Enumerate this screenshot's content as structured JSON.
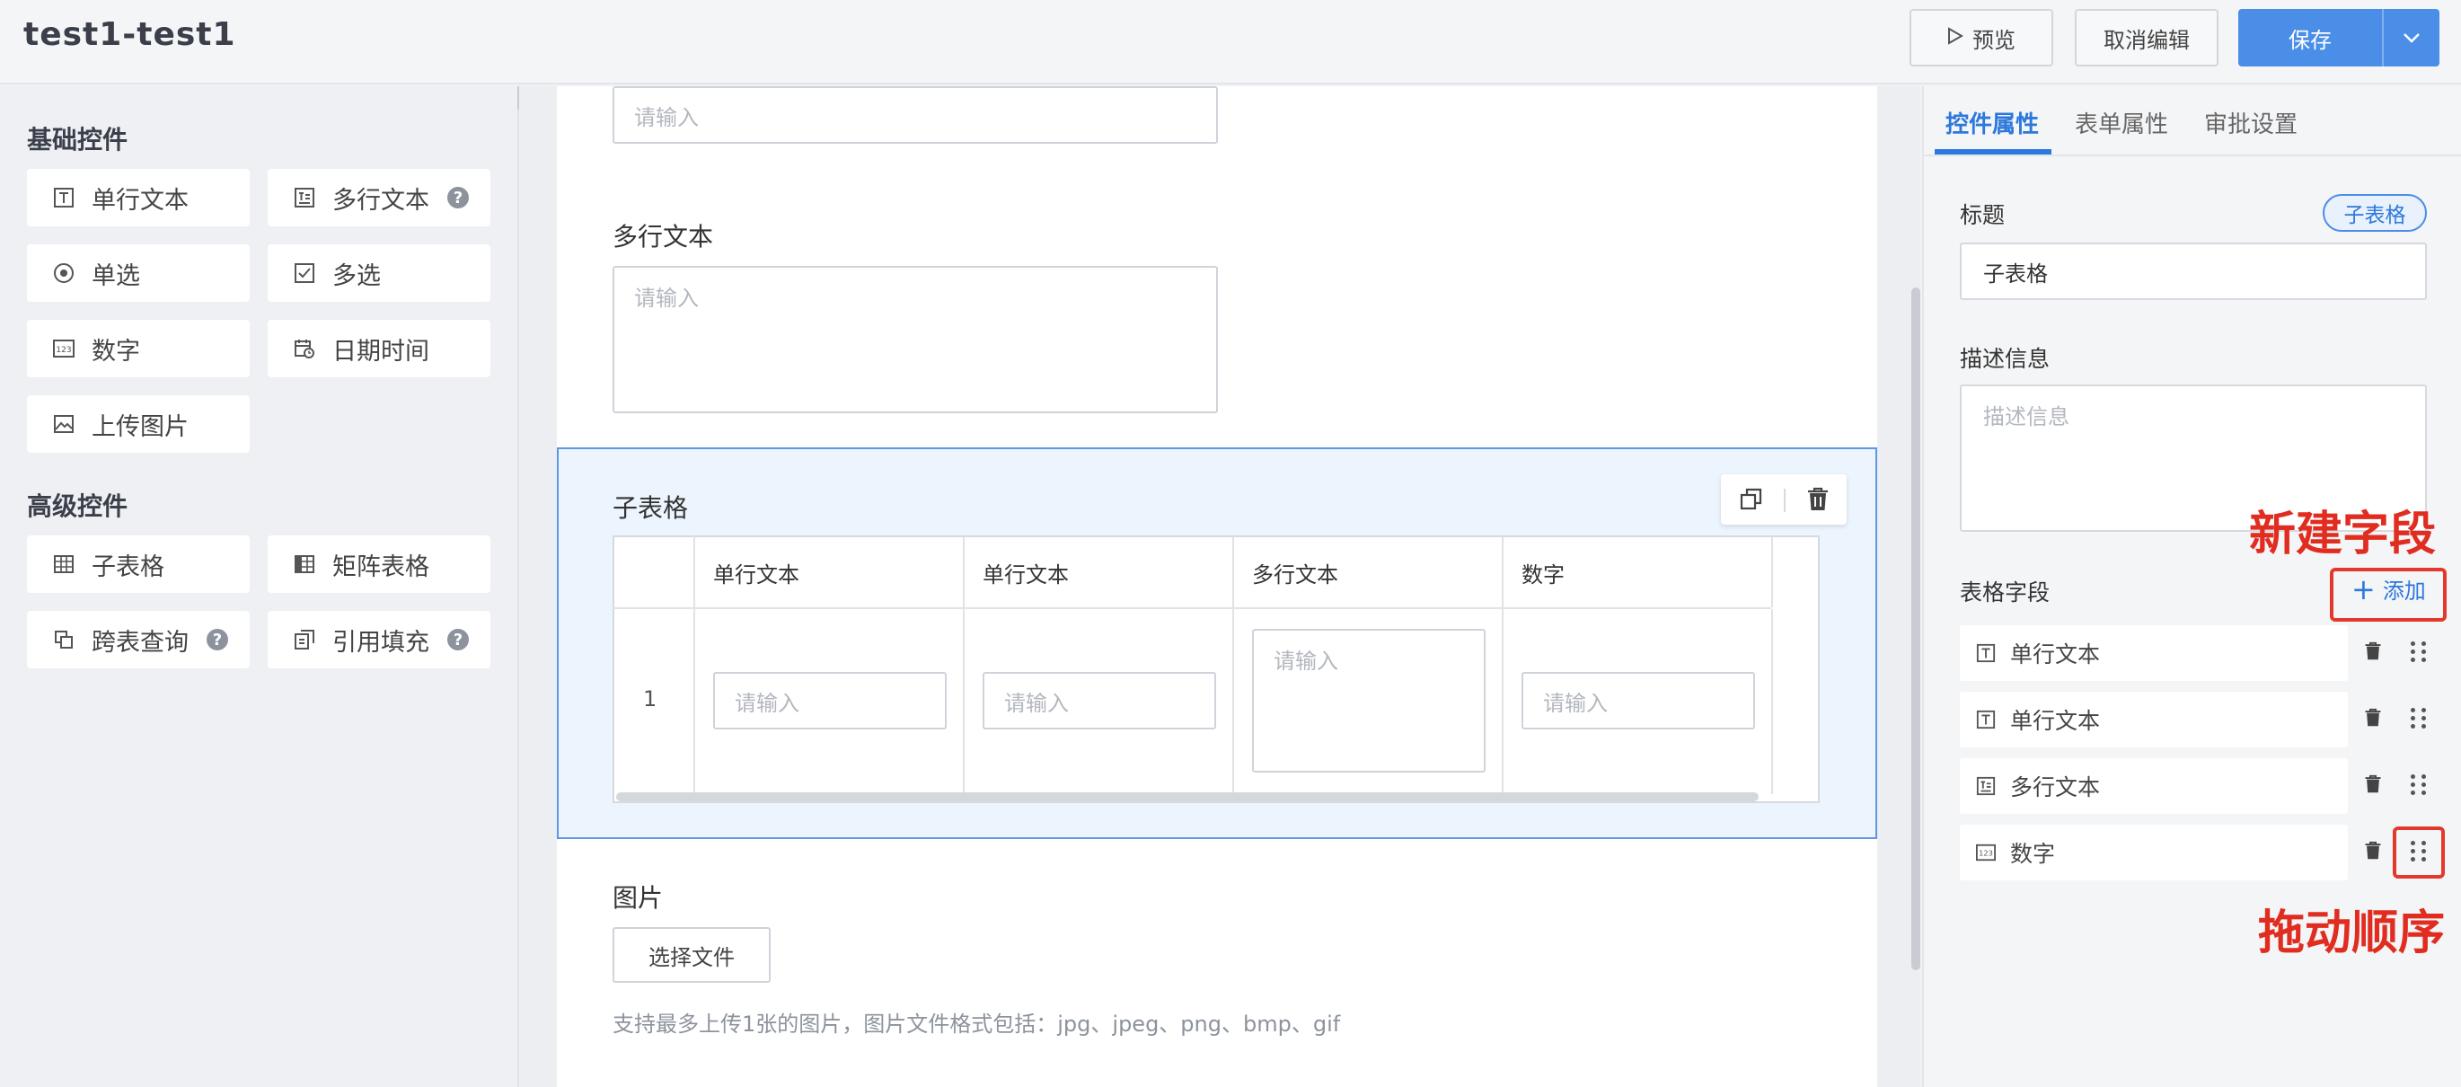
{
  "header": {
    "title": "test1-test1",
    "preview_label": "预览",
    "cancel_edit_label": "取消编辑",
    "save_label": "保存"
  },
  "left_panel": {
    "basic_section_title": "基础控件",
    "basic_widgets": [
      {
        "label": "单行文本",
        "icon": "single-line-text-icon"
      },
      {
        "label": "多行文本",
        "icon": "multi-line-text-icon",
        "help": "?"
      },
      {
        "label": "单选",
        "icon": "radio-icon"
      },
      {
        "label": "多选",
        "icon": "checkbox-icon"
      },
      {
        "label": "数字",
        "icon": "number-icon"
      },
      {
        "label": "日期时间",
        "icon": "calendar-icon"
      },
      {
        "label": "上传图片",
        "icon": "image-icon"
      }
    ],
    "advanced_section_title": "高级控件",
    "advanced_widgets": [
      {
        "label": "子表格",
        "icon": "table-icon"
      },
      {
        "label": "矩阵表格",
        "icon": "matrix-table-icon"
      },
      {
        "label": "跨表查询",
        "icon": "cross-query-icon",
        "help": "?"
      },
      {
        "label": "引用填充",
        "icon": "reference-fill-icon",
        "help": "?"
      }
    ]
  },
  "canvas": {
    "top_input_placeholder": "请输入",
    "multiline_label": "多行文本",
    "multiline_placeholder": "请输入",
    "subtable": {
      "label": "子表格",
      "columns": [
        "单行文本",
        "单行文本",
        "多行文本",
        "数字"
      ],
      "row_number": "1",
      "cell_placeholder": "请输入"
    },
    "image_field": {
      "label": "图片",
      "button_label": "选择文件",
      "hint": "支持最多上传1张的图片，图片文件格式包括：jpg、jpeg、png、bmp、gif"
    }
  },
  "right_panel": {
    "tabs": [
      "控件属性",
      "表单属性",
      "审批设置"
    ],
    "active_tab": "控件属性",
    "title_label": "标题",
    "type_badge": "子表格",
    "title_value": "子表格",
    "desc_label": "描述信息",
    "desc_placeholder": "描述信息",
    "fields_label": "表格字段",
    "add_label": "添加",
    "fields": [
      {
        "label": "单行文本",
        "icon": "single-line-text-icon"
      },
      {
        "label": "单行文本",
        "icon": "single-line-text-icon"
      },
      {
        "label": "多行文本",
        "icon": "multi-line-text-icon"
      },
      {
        "label": "数字",
        "icon": "number-icon"
      }
    ]
  },
  "annotations": {
    "new_field": "新建字段",
    "drag_order": "拖动顺序"
  },
  "colors": {
    "accent": "#4a8ee8",
    "active_tab": "#2c78dc",
    "selection_bg": "#ecf4fd",
    "annotation_red": "#e02d20"
  }
}
